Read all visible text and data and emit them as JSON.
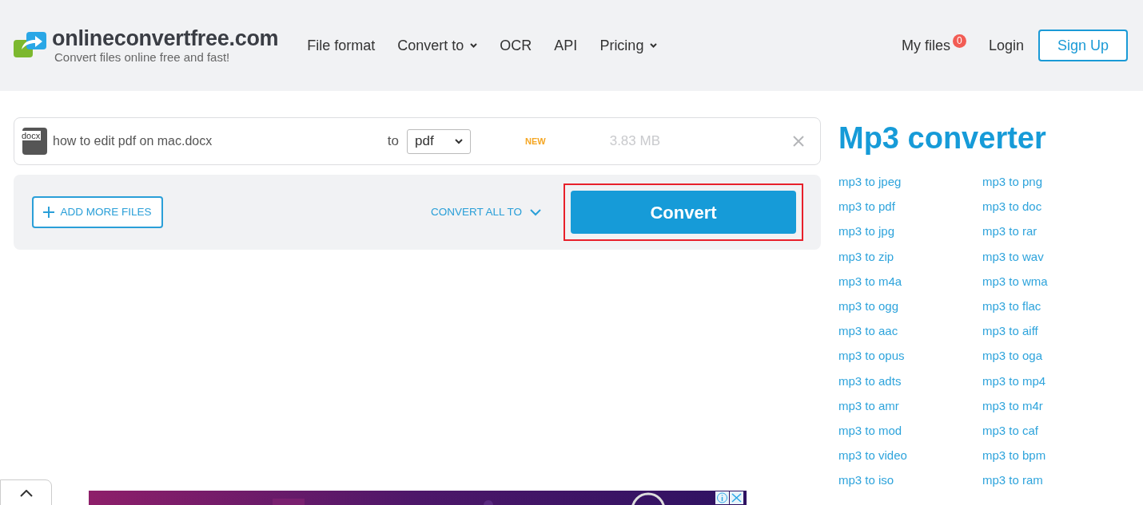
{
  "header": {
    "logo": "onlineconvertfree.com",
    "tagline": "Convert files online free and fast!",
    "nav": [
      {
        "label": "File format",
        "has_dropdown": false
      },
      {
        "label": "Convert to",
        "has_dropdown": true
      },
      {
        "label": "OCR",
        "has_dropdown": false
      },
      {
        "label": "API",
        "has_dropdown": false
      },
      {
        "label": "Pricing",
        "has_dropdown": true
      }
    ],
    "my_files": {
      "label": "My files",
      "count": "0"
    },
    "login": "Login",
    "signup": "Sign Up"
  },
  "file": {
    "icon_label": "docx",
    "name": "how to edit pdf on mac.docx",
    "to": "to",
    "format": "pdf",
    "badge": "NEW",
    "size": "3.83 MB"
  },
  "actions": {
    "add_more": "ADD MORE FILES",
    "convert_all": "CONVERT ALL TO",
    "convert": "Convert",
    "convert_highlighted": true
  },
  "sidebar": {
    "title": "Mp3 converter",
    "links": [
      "mp3 to jpeg",
      "mp3 to png",
      "mp3 to pdf",
      "mp3 to doc",
      "mp3 to jpg",
      "mp3 to rar",
      "mp3 to zip",
      "mp3 to wav",
      "mp3 to m4a",
      "mp3 to wma",
      "mp3 to ogg",
      "mp3 to flac",
      "mp3 to aac",
      "mp3 to aiff",
      "mp3 to opus",
      "mp3 to oga",
      "mp3 to adts",
      "mp3 to mp4",
      "mp3 to amr",
      "mp3 to m4r",
      "mp3 to mod",
      "mp3 to caf",
      "mp3 to video",
      "mp3 to bpm",
      "mp3 to iso",
      "mp3 to ram"
    ]
  }
}
